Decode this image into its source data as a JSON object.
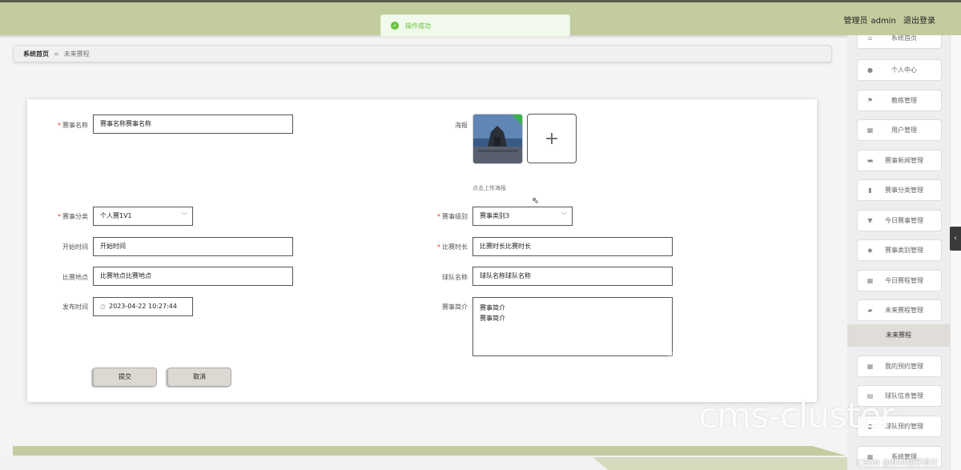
{
  "header": {
    "admin_prefix": "管理员",
    "admin_name": "admin",
    "logout": "退出登录",
    "accent": "#c3cc9e"
  },
  "toast": {
    "icon": "check-circle-icon",
    "message": "操作成功",
    "color": "#67c23a"
  },
  "breadcrumb": {
    "home": "系统首页",
    "separator": "≡",
    "current": "未来赛程"
  },
  "form": {
    "event_name": {
      "label": "赛事名称",
      "value": "赛事名称赛事名称",
      "required": true
    },
    "poster": {
      "label": "海报",
      "tip": "点击上传海报",
      "add_symbol": "+"
    },
    "category": {
      "label": "赛事分类",
      "value": "个人赛1V1",
      "required": true
    },
    "level": {
      "label": "赛事级别",
      "value": "赛事类别3",
      "required": true
    },
    "start_time": {
      "label": "开始时间",
      "value": "开始时间"
    },
    "duration": {
      "label": "比赛时长",
      "value": "比赛时长比赛时长",
      "required": true
    },
    "location": {
      "label": "比赛地点",
      "value": "比赛地点比赛地点"
    },
    "team": {
      "label": "球队名称",
      "value": "球队名称球队名称"
    },
    "publish_time": {
      "label": "发布时间",
      "value": "2023-04-22 10:27:44"
    },
    "intro": {
      "label": "赛事简介",
      "value": "赛事简介\n赛事简介"
    },
    "submit": "提交",
    "cancel": "取消"
  },
  "sidebar": {
    "items": [
      {
        "label": "系统首页",
        "icon": "home-icon"
      },
      {
        "label": "个人中心",
        "icon": "user-icon"
      },
      {
        "label": "教练管理",
        "icon": "flag-icon"
      },
      {
        "label": "用户管理",
        "icon": "grid-icon"
      },
      {
        "label": "赛事新闻管理",
        "icon": "briefcase-icon"
      },
      {
        "label": "赛事分类管理",
        "icon": "bar-chart-icon"
      },
      {
        "label": "今日赛事管理",
        "icon": "trophy-icon"
      },
      {
        "label": "赛事类别管理",
        "icon": "location-icon"
      },
      {
        "label": "今日赛程管理",
        "icon": "grid-icon"
      },
      {
        "label": "未来赛程管理",
        "icon": "ticket-icon"
      },
      {
        "label": "我的预约管理",
        "icon": "grid-icon"
      },
      {
        "label": "球队信息管理",
        "icon": "clipboard-icon"
      },
      {
        "label": "球队预约管理",
        "icon": "user-icon"
      },
      {
        "label": "系统管理",
        "icon": "grid-icon"
      }
    ],
    "active_sub": "未来赛程",
    "collapse_icon": "‹"
  },
  "watermark": {
    "big": "cms-cluster",
    "small": "CSDN @林科程序设计"
  }
}
